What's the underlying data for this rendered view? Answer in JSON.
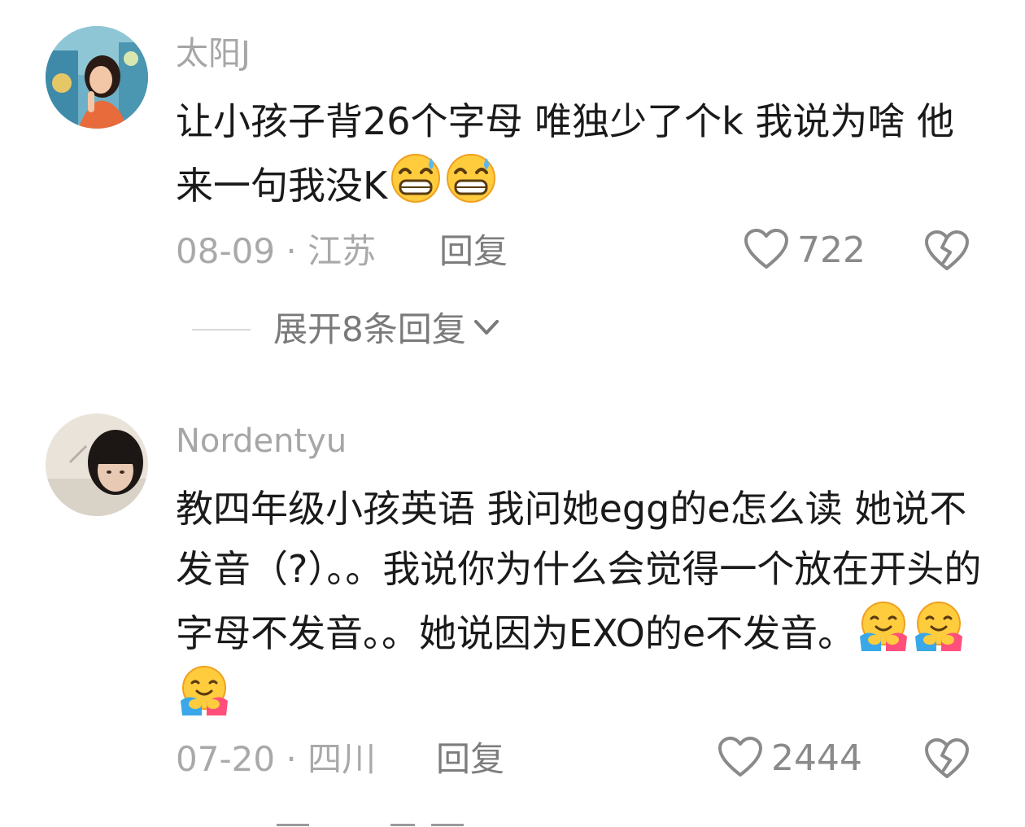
{
  "comments": [
    {
      "username": "太阳J",
      "text": "让小孩子背26个字母 唯独少了个k 我说为啥 他来一句我没K",
      "emoji": [
        "sweat-grin-emoji",
        "sweat-grin-emoji"
      ],
      "date": "08-09",
      "location": "江苏",
      "reply_label": "回复",
      "likes": "722",
      "expand_label": "展开8条回复"
    },
    {
      "username": "Nordentyu",
      "text": "教四年级小孩英语 我问她egg的e怎么读 她说不发音（?）。。我说你为什么会觉得一个放在开头的字母不发音。。她说因为EXO的e不发音。",
      "emoji": [
        "hugging-face-emoji",
        "hugging-face-emoji",
        "hugging-face-emoji"
      ],
      "date": "07-20",
      "location": "四川",
      "reply_label": "回复",
      "likes": "2444"
    }
  ],
  "colors": {
    "meta_gray": "#a9a9a9",
    "text_dark": "#1a1a1a",
    "username_gray": "#a6a6a6"
  }
}
